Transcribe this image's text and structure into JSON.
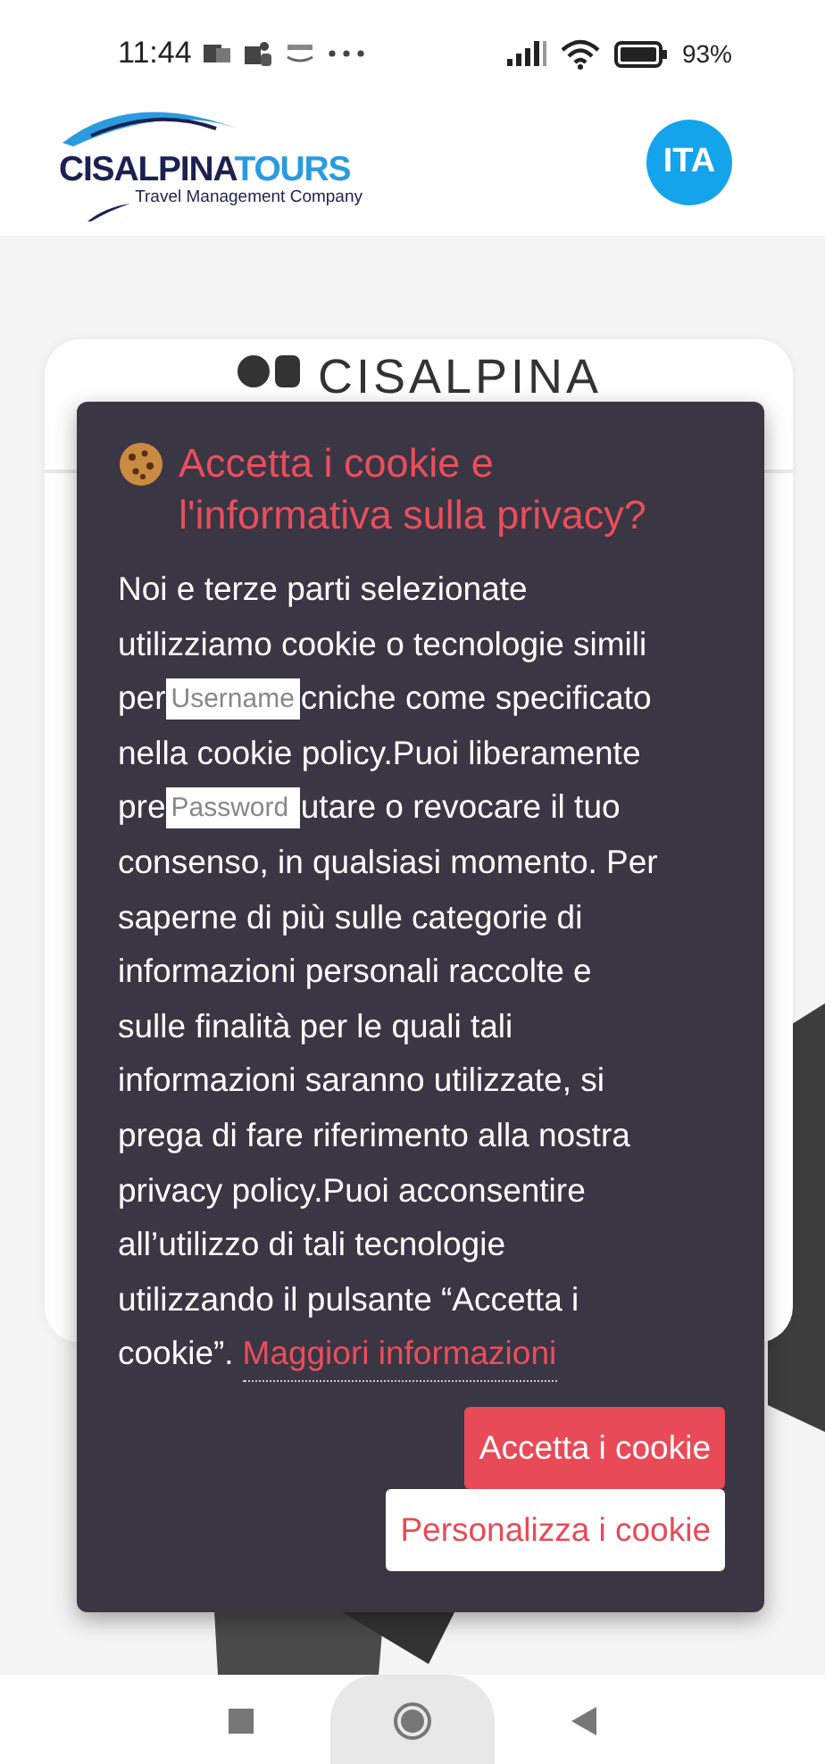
{
  "status_bar": {
    "time": "11:44",
    "battery": "93%"
  },
  "header": {
    "logo": {
      "name_dark": "CISALPINA",
      "name_light": "TOURS",
      "tagline": "Travel Management Company"
    },
    "language_button": "ITA"
  },
  "login_card": {
    "logo_text": "CISALPINA"
  },
  "cookie_dialog": {
    "title": "Accetta i cookie e l'informativa sulla privacy?",
    "body_lines": [
      [
        {
          "kind": "text",
          "text": "Noi e terze parti selezionate"
        }
      ],
      [
        {
          "kind": "text",
          "text": "utilizziamo cookie o tecnologie simili"
        }
      ],
      [
        {
          "kind": "text",
          "text": "per"
        },
        {
          "kind": "field",
          "placeholder": "Username"
        },
        {
          "kind": "text",
          "text": "cniche come specificato"
        }
      ],
      [
        {
          "kind": "text",
          "text": "nella cookie policy.Puoi liberamente"
        }
      ],
      [
        {
          "kind": "text",
          "text": "pre"
        },
        {
          "kind": "field",
          "placeholder": "Password"
        },
        {
          "kind": "text",
          "text": "utare o revocare il tuo"
        }
      ],
      [
        {
          "kind": "text",
          "text": "consenso, in qualsiasi momento. Per"
        }
      ],
      [
        {
          "kind": "text",
          "text": "saperne di più sulle categorie di"
        }
      ],
      [
        {
          "kind": "text",
          "text": "informazioni personali raccolte e"
        }
      ],
      [
        {
          "kind": "text",
          "text": "sulle finalità per le quali tali"
        }
      ],
      [
        {
          "kind": "text",
          "text": "informazioni saranno utilizzate, si"
        }
      ],
      [
        {
          "kind": "text",
          "text": "prega di fare riferimento alla nostra"
        }
      ],
      [
        {
          "kind": "text",
          "text": "privacy policy.Puoi acconsentire"
        }
      ],
      [
        {
          "kind": "text",
          "text": "all’utilizzo di tali tecnologie"
        }
      ],
      [
        {
          "kind": "text",
          "text": "utilizzando il pulsante “Accetta i"
        }
      ],
      [
        {
          "kind": "text",
          "text": "cookie”."
        },
        {
          "kind": "link",
          "text": "Maggiori informazioni"
        }
      ]
    ],
    "buttons": [
      {
        "label": "Accetta i cookie",
        "kind": "primary"
      },
      {
        "label": "Personalizza i cookie",
        "kind": "secondary"
      }
    ]
  }
}
